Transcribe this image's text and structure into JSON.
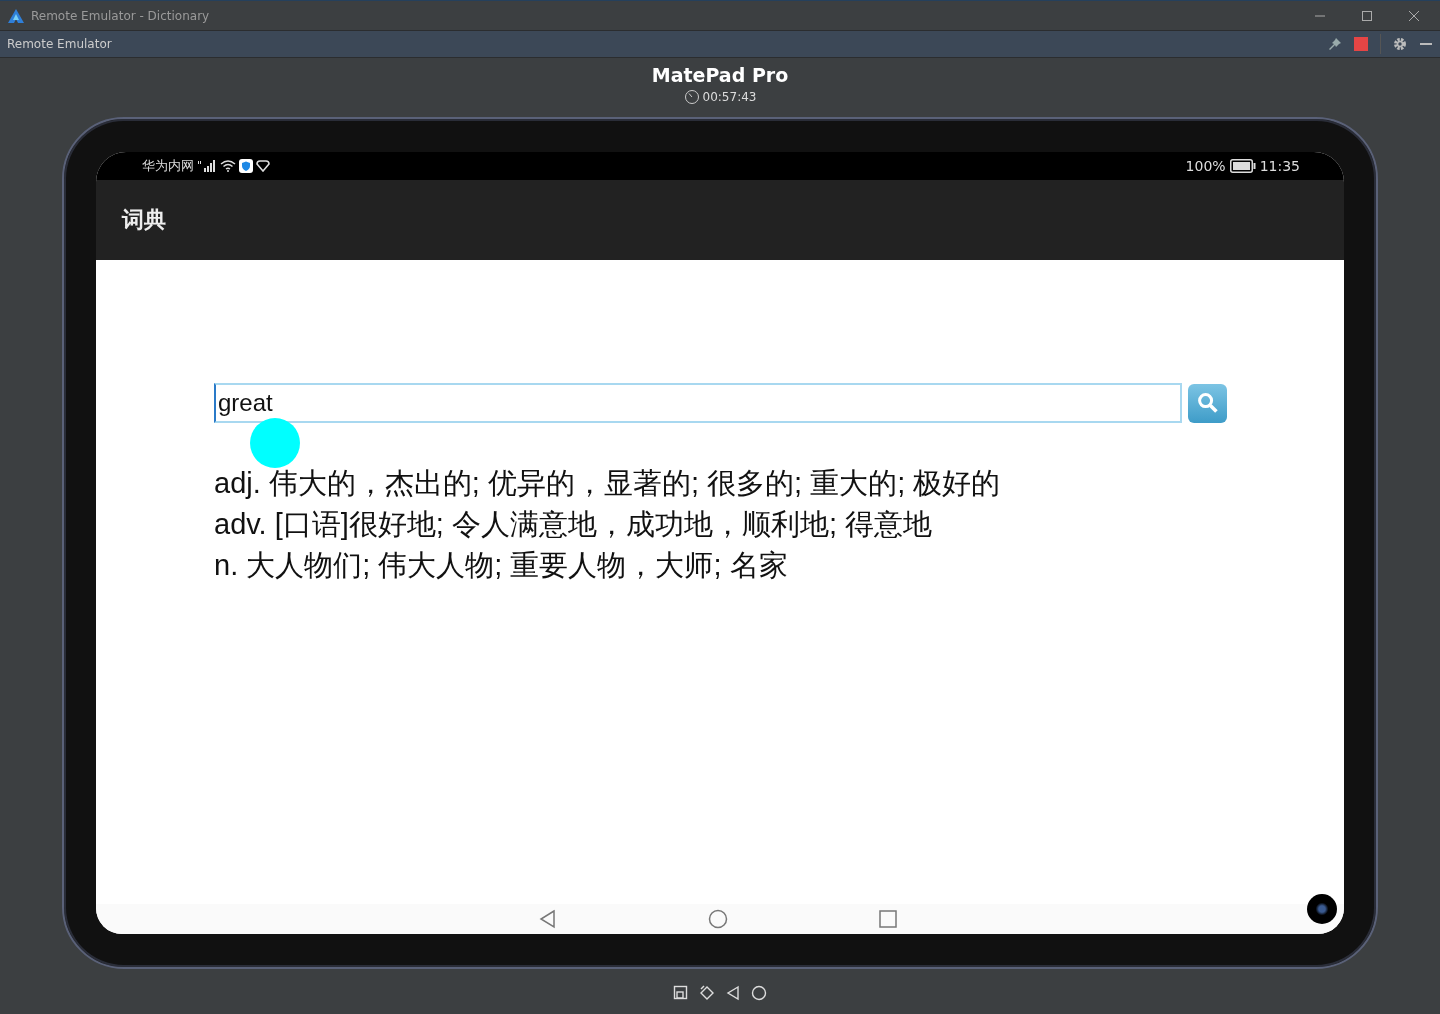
{
  "window": {
    "title": "Remote Emulator - Dictionary"
  },
  "panel": {
    "title": "Remote Emulator"
  },
  "device": {
    "name": "MatePad Pro",
    "timer": "00:57:43"
  },
  "status_bar": {
    "carrier": "华为内网",
    "battery": "100%",
    "time": "11:35"
  },
  "app": {
    "title": "词典",
    "search": {
      "value": "great"
    },
    "definitions": [
      "adj. 伟大的，杰出的; 优异的，显著的; 很多的; 重大的; 极好的",
      "adv. [口语]很好地; 令人满意地，成功地，顺利地; 得意地",
      "n. 大人物们; 伟大人物; 重要人物，大师; 名家"
    ]
  }
}
